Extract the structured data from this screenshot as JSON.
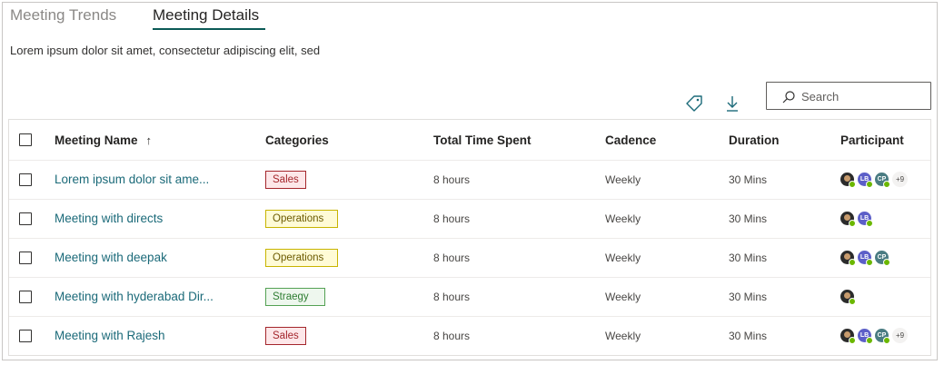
{
  "tabs": [
    {
      "label": "Meeting Trends",
      "active": false
    },
    {
      "label": "Meeting Details",
      "active": true
    }
  ],
  "subtitle": "Lorem ipsum dolor sit amet, consectetur adipiscing elit, sed",
  "toolbar": {
    "tag_icon": "tag-icon",
    "download_icon": "download-icon",
    "search_placeholder": "Search"
  },
  "table": {
    "columns": {
      "name": "Meeting Name",
      "categories": "Categories",
      "time": "Total Time Spent",
      "cadence": "Cadence",
      "duration": "Duration",
      "participant": "Participant"
    },
    "sort_indicator": "↑",
    "rows": [
      {
        "name": "Lorem ipsum dolor sit ame...",
        "category": "Sales",
        "time": "8 hours",
        "cadence": "Weekly",
        "duration": "30 Mins",
        "more": "+9"
      },
      {
        "name": "Meeting with directs",
        "category": "Operations",
        "time": "8 hours",
        "cadence": "Weekly",
        "duration": "30 Mins",
        "more": ""
      },
      {
        "name": "Meeting with deepak",
        "category": "Operations",
        "time": "8 hours",
        "cadence": "Weekly",
        "duration": "30 Mins",
        "more": ""
      },
      {
        "name": "Meeting with hyderabad Dir...",
        "category": "Straegy",
        "time": "8 hours",
        "cadence": "Weekly",
        "duration": "30 Mins",
        "more": ""
      },
      {
        "name": "Meeting with Rajesh",
        "category": "Sales",
        "time": "8 hours",
        "cadence": "Weekly",
        "duration": "30 Mins",
        "more": "+9"
      }
    ],
    "avatar_initials": {
      "lb": "LB",
      "cp": "CP"
    }
  },
  "colors": {
    "accent": "#0b5a56",
    "link": "#1b6a79",
    "sales": "#a4262c",
    "operations": "#c8b400",
    "strategy": "#54a154",
    "presence": "#6bb700"
  }
}
